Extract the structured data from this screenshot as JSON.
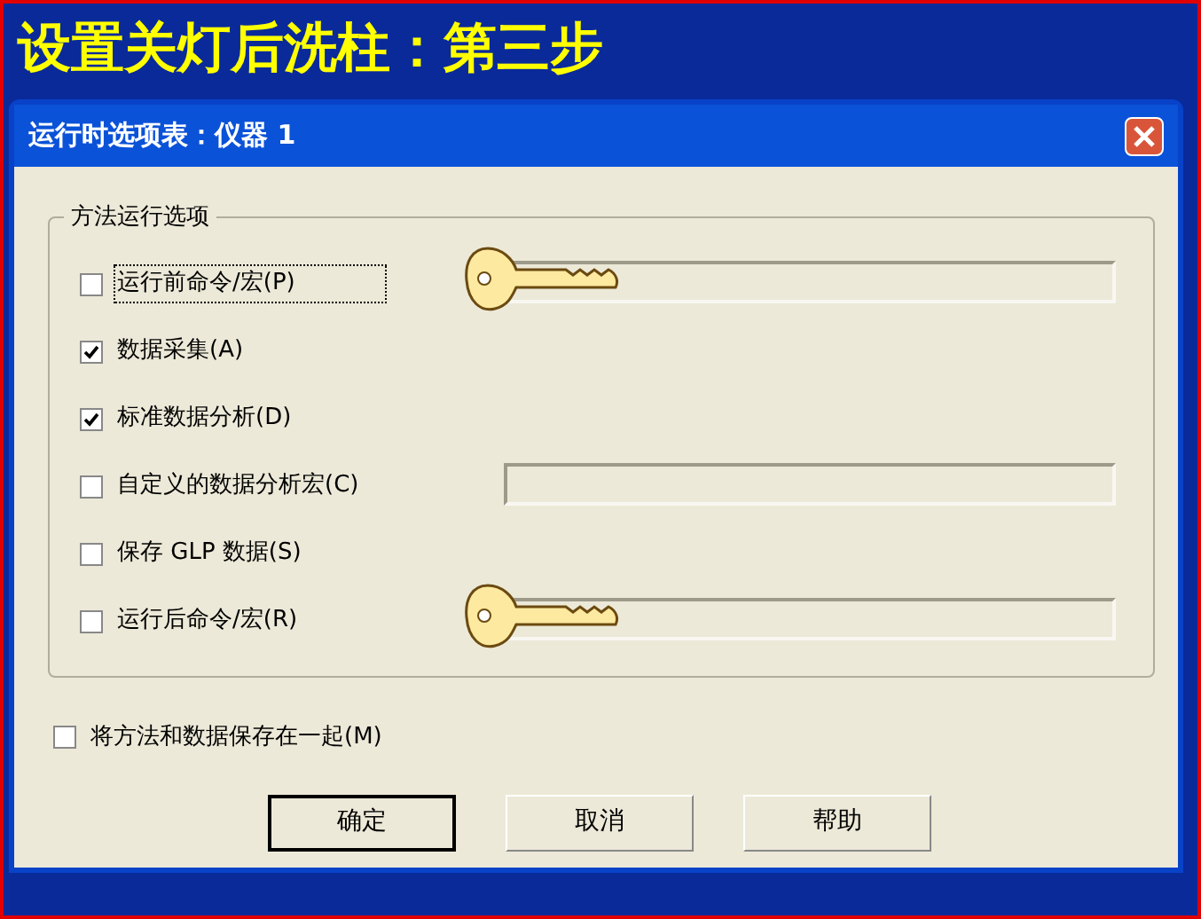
{
  "slide_title": "设置关灯后洗柱：第三步",
  "window": {
    "title": "运行时选项表：仪器 1"
  },
  "group": {
    "title": "方法运行选项",
    "options": [
      {
        "label": "运行前命令/宏(P)",
        "checked": false,
        "focused": true,
        "has_field": true,
        "key": true
      },
      {
        "label": "数据采集(A)",
        "checked": true,
        "focused": false,
        "has_field": false,
        "key": false
      },
      {
        "label": "标准数据分析(D)",
        "checked": true,
        "focused": false,
        "has_field": false,
        "key": false
      },
      {
        "label": "自定义的数据分析宏(C)",
        "checked": false,
        "focused": false,
        "has_field": true,
        "key": false
      },
      {
        "label": "保存 GLP 数据(S)",
        "checked": false,
        "focused": false,
        "has_field": false,
        "key": false
      },
      {
        "label": "运行后命令/宏(R)",
        "checked": false,
        "focused": false,
        "has_field": true,
        "key": true
      }
    ]
  },
  "save_together": {
    "label": "将方法和数据保存在一起(M)",
    "checked": false
  },
  "buttons": [
    {
      "label": "确定",
      "default": true
    },
    {
      "label": "取消",
      "default": false
    },
    {
      "label": "帮助",
      "default": false
    }
  ]
}
